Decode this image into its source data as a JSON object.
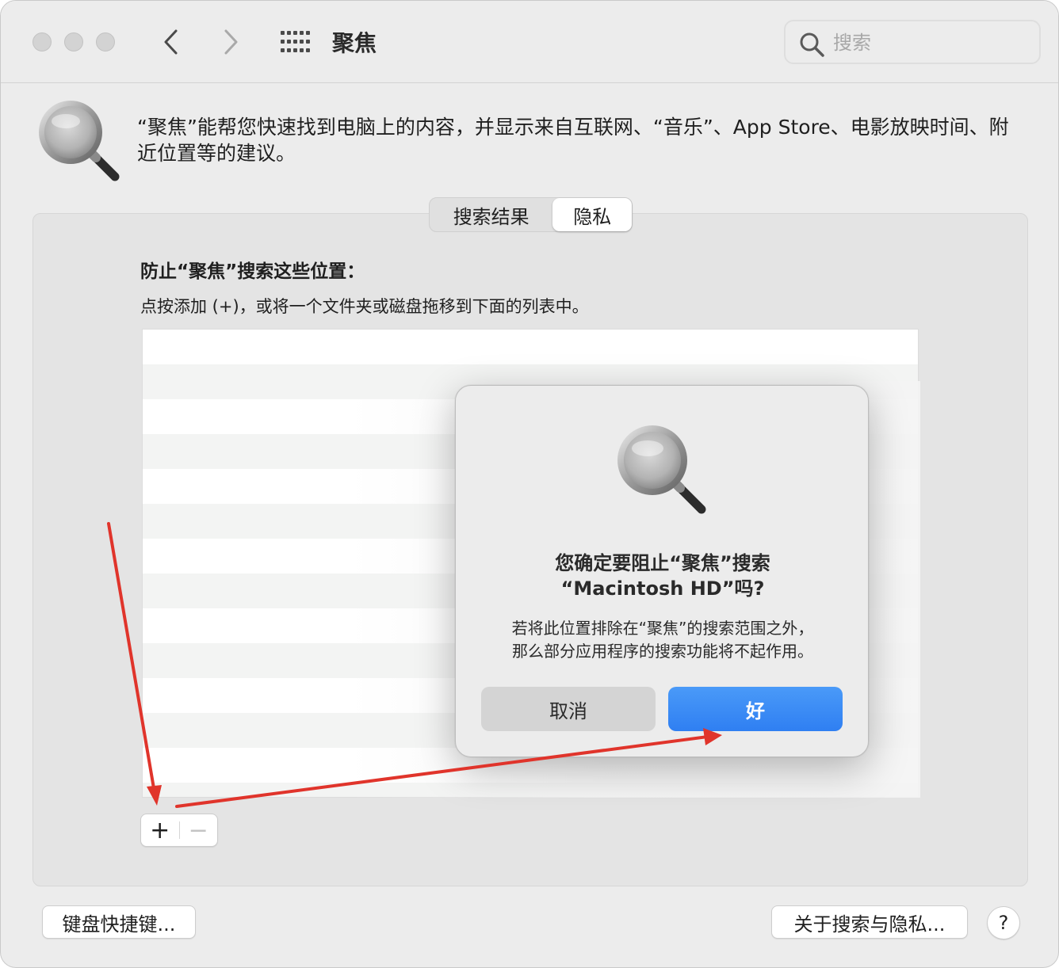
{
  "toolbar": {
    "title": "聚焦",
    "search_placeholder": "搜索"
  },
  "header": {
    "description": "“聚焦”能帮您快速找到电脑上的内容，并显示来自互联网、“音乐”、App Store、电影放映时间、附近位置等的建议。"
  },
  "tabs": [
    {
      "label": "搜索结果",
      "selected": false
    },
    {
      "label": "隐私",
      "selected": true
    }
  ],
  "privacy": {
    "title": "防止“聚焦”搜索这些位置：",
    "subtitle": "点按添加 (+)，或将一个文件夹或磁盘拖移到下面的列表中。",
    "add_label": "+",
    "remove_label": "−"
  },
  "footer": {
    "keyboard_shortcuts": "键盘快捷键...",
    "about_privacy": "关于搜索与隐私...",
    "help": "?"
  },
  "dialog": {
    "title_line1": "您确定要阻止“聚焦”搜索",
    "title_line2": "“Macintosh HD”吗?",
    "message_line1": "若将此位置排除在“聚焦”的搜索范围之外，",
    "message_line2": "那么部分应用程序的搜索功能将不起作用。",
    "cancel_label": "取消",
    "ok_label": "好"
  },
  "colors": {
    "accent": "#2f7ff2",
    "annotation_arrow": "#e0342b"
  }
}
